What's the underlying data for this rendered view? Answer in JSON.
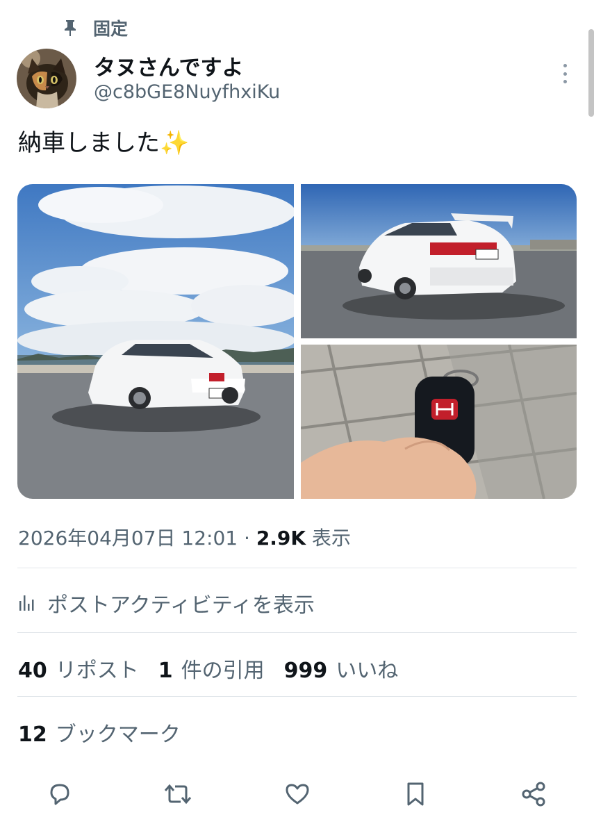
{
  "pinned": {
    "label": "固定",
    "icon": "pin-icon"
  },
  "author": {
    "display_name": "タヌさんですよ",
    "handle": "@c8bGE8NuyfhxiKu",
    "avatar_icon": "cat-avatar"
  },
  "tweet": {
    "text": "納車しました✨",
    "media": [
      {
        "name": "car-front-photo",
        "subject": "white sedan, sky with clouds"
      },
      {
        "name": "car-rear-photo",
        "subject": "white sedan with rear spoiler"
      },
      {
        "name": "car-key-photo",
        "subject": "key with red H badge held in hand"
      }
    ]
  },
  "meta": {
    "timestamp": "2026年04月07日 12:01",
    "separator": " · ",
    "views_count": "2.9K",
    "views_label": " 表示"
  },
  "activity": {
    "label": "ポストアクティビティを表示",
    "icon": "bar-chart-icon"
  },
  "stats": {
    "reposts": {
      "count": "40",
      "label": "リポスト"
    },
    "quotes": {
      "count": "1",
      "label": "件の引用"
    },
    "likes": {
      "count": "999",
      "label": "いいね"
    }
  },
  "bookmarks": {
    "count": "12",
    "label": "ブックマーク"
  },
  "actions": [
    "reply-icon",
    "repost-icon",
    "like-icon",
    "bookmark-icon",
    "share-icon"
  ],
  "colors": {
    "text": "#0f1419",
    "secondary": "#536471",
    "divider": "#e1e6ea"
  }
}
